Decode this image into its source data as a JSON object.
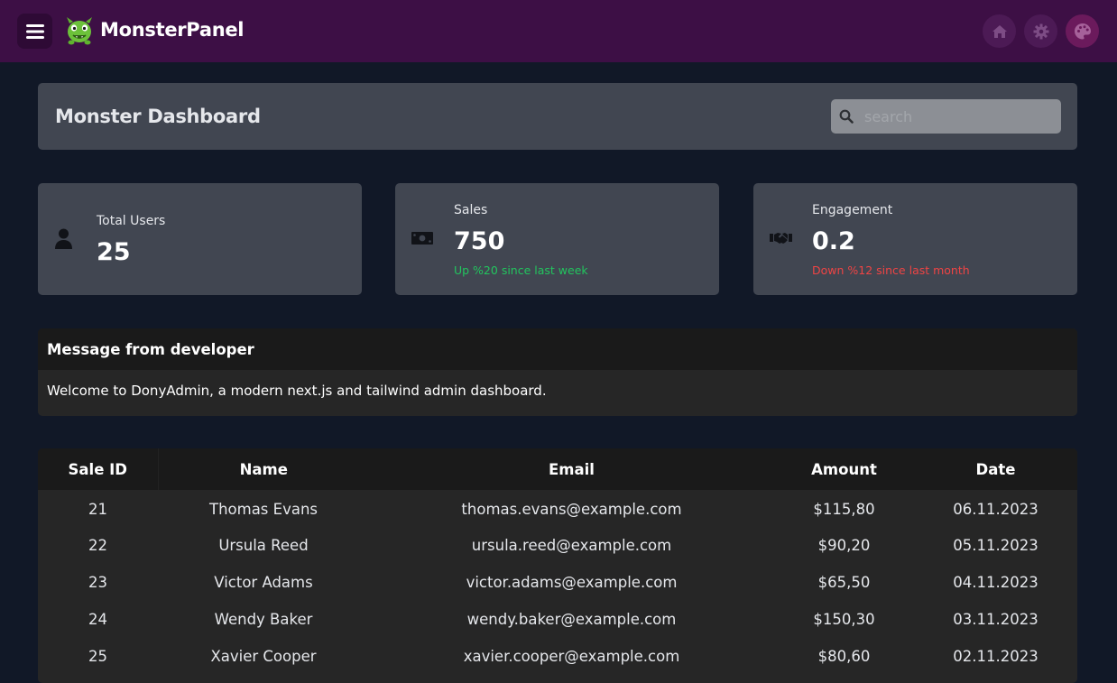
{
  "topbar": {
    "brand": "MonsterPanel",
    "icons": [
      "menu-icon",
      "monster-logo",
      "home-icon",
      "gear-icon",
      "palette-icon"
    ],
    "bg_color": "#3d0f45"
  },
  "header": {
    "title": "Monster Dashboard",
    "search_placeholder": "search"
  },
  "stats": [
    {
      "label": "Total Users",
      "value": "25",
      "icon": "user-icon"
    },
    {
      "label": "Sales",
      "value": "750",
      "delta": "Up %20 since last week",
      "trend": "up",
      "icon": "money-icon"
    },
    {
      "label": "Engagement",
      "value": "0.2",
      "delta": "Down %12 since last month",
      "trend": "down",
      "icon": "handshake-icon"
    }
  ],
  "message": {
    "title": "Message from developer",
    "body": "Welcome to DonyAdmin, a modern next.js and tailwind admin dashboard."
  },
  "table": {
    "headers": [
      "Sale ID",
      "Name",
      "Email",
      "Amount",
      "Date"
    ],
    "rows": [
      [
        "21",
        "Thomas Evans",
        "thomas.evans@example.com",
        "$115,80",
        "06.11.2023"
      ],
      [
        "22",
        "Ursula Reed",
        "ursula.reed@example.com",
        "$90,20",
        "05.11.2023"
      ],
      [
        "23",
        "Victor Adams",
        "victor.adams@example.com",
        "$65,50",
        "04.11.2023"
      ],
      [
        "24",
        "Wendy Baker",
        "wendy.baker@example.com",
        "$150,30",
        "03.11.2023"
      ],
      [
        "25",
        "Xavier Cooper",
        "xavier.cooper@example.com",
        "$80,60",
        "02.11.2023"
      ]
    ]
  },
  "colors": {
    "up": "#22c55e",
    "down": "#ef4444",
    "card": "#414651",
    "page_bg": "#111827"
  }
}
